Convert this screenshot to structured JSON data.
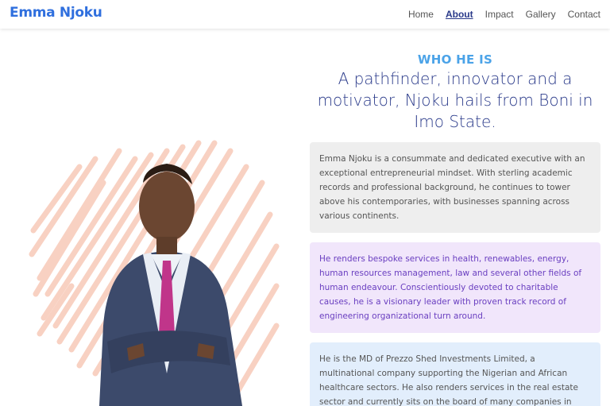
{
  "header": {
    "brand": "Emma Njoku",
    "nav": [
      "Home",
      "About",
      "Impact",
      "Gallery",
      "Contact"
    ],
    "active_nav": "About"
  },
  "about": {
    "eyebrow": "WHO HE IS",
    "headline": "A pathfinder, innovator and a motivator, Njoku hails from Boni in Imo State.",
    "cards": [
      "Emma Njoku is a consummate and dedicated executive with an exceptional entrepreneurial mindset. With sterling academic records and professional background, he continues to tower above his contemporaries, with businesses spanning across various continents.",
      "He renders bespoke services in health, renewables, energy, human resources management, law and several other fields of human endeavour. Conscientiously devoted to charitable causes, he is a visionary leader with proven track record of engineering organizational turn around.",
      "He is the MD of Prezzo Shed Investments Limited, a multinational company supporting the Nigerian and African healthcare sectors. He also renders services in the real estate sector and currently sits on the board of many companies in"
    ]
  },
  "colors": {
    "brand": "#2f6fde",
    "eyebrow": "#4ba3e8",
    "headline": "#2a3a8a",
    "scribble": "#f7c9b8",
    "card1": "#eeeeee",
    "card2": "#f1e6fb",
    "card3": "#e2eefc"
  }
}
